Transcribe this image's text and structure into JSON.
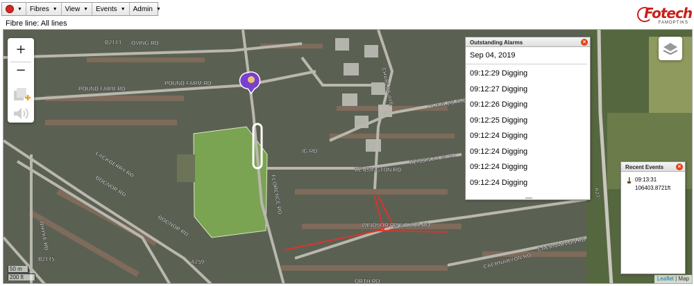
{
  "menubar": {
    "items": [
      {
        "label": "Fibres"
      },
      {
        "label": "View"
      },
      {
        "label": "Events"
      },
      {
        "label": "Admin"
      }
    ]
  },
  "fibre_line": "Fibre line: All lines",
  "logo": {
    "text": "Fotech",
    "subtext": "FAMOPTIKS"
  },
  "map": {
    "zoom_in": "+",
    "zoom_out": "−",
    "streets": [
      "OVING RD",
      "B2144",
      "POUND FARM RD",
      "POUND FARM RD",
      "CHARLES AVE",
      "CHARLES AVE",
      "KENSINGTON RD",
      "KENSINGTON RD",
      "WINDSOR RD",
      "WINDSOR RD",
      "CAERNARVON RD",
      "CAERNARVON RD",
      "A27",
      "A259",
      "B2145",
      "FLORENCE RD",
      "LACKBERRY RD",
      "BOGNOR RD",
      "BOGNOR RD",
      "WHYKE RD",
      "ORTH RD",
      "IG RD"
    ],
    "scale_metric": "50 m",
    "scale_imperial": "200 ft",
    "attribution_link": "Leaflet",
    "attribution_text": "| Map"
  },
  "alarm_panel": {
    "title": "Outstanding Alarms",
    "date": "Sep 04, 2019",
    "alarms": [
      "09:12:29 Digging",
      "09:12:27 Digging",
      "09:12:26 Digging",
      "09:12:25 Digging",
      "09:12:24 Digging",
      "09:12:24 Digging",
      "09:12:24 Digging",
      "09:12:24 Digging"
    ]
  },
  "events_panel": {
    "title": "Recent Events",
    "event": {
      "time": "09:13:31",
      "position": "106403.8721ft"
    }
  },
  "colors": {
    "accent": "#d7261e",
    "close": "#e2421b",
    "fibre_route": "#e0312b",
    "alarm_zone": "#ffffff",
    "marker": "#7b3fd0"
  }
}
